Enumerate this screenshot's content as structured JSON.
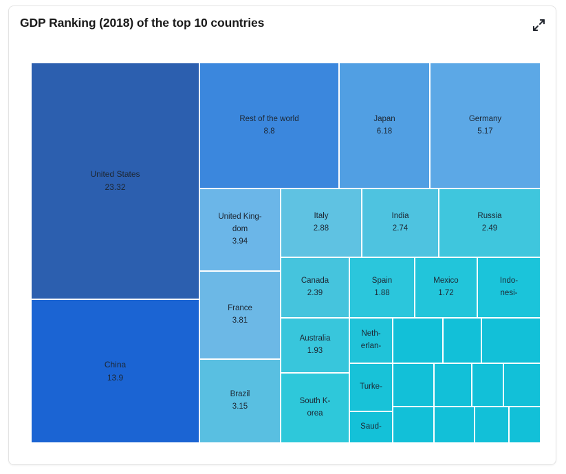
{
  "card": {
    "title": "GDP Ranking (2018) of the top 10 countries",
    "expand_icon": "expand-diagonal-arrows-icon"
  },
  "colors": {
    "united_states": "#2c5faf",
    "china": "#1b64d3",
    "rest_of_world": "#3b87dd",
    "japan": "#519fe3",
    "germany": "#5ca8e6",
    "united_kingdom": "#6bb6e8",
    "france": "#6cb8e6",
    "brazil": "#59bfe1",
    "italy": "#5fc2e2",
    "india": "#4ec3e0",
    "russia": "#3fc6dd",
    "canada": "#45c4dd",
    "australia": "#38c6dc",
    "south_korea": "#2ec8da",
    "spain": "#2bc6dc",
    "mexico": "#22c5da",
    "indonesia": "#1bc4da",
    "netherlands": "#20c3d9",
    "turkey": "#18c2d8",
    "saudi_arabia": "#14c1d8",
    "small": "#12c0d8",
    "tile_border": "#ffffff",
    "card_border": "#e3e3e3",
    "title_text": "#1a1a1a",
    "tile_text": "#1d2733"
  },
  "chart_data": {
    "type": "treemap",
    "title": "GDP Ranking (2018) of the top 10 countries",
    "unit_note": "",
    "value_label_suffix": "",
    "items": [
      {
        "name": "United States",
        "value": "23.32"
      },
      {
        "name": "China",
        "value": "13.9"
      },
      {
        "name": "Rest of the world",
        "value": "8.8"
      },
      {
        "name": "Japan",
        "value": "6.18"
      },
      {
        "name": "Germany",
        "value": "5.17"
      },
      {
        "name": "United King-\ndom",
        "value": "3.94"
      },
      {
        "name": "France",
        "value": "3.81"
      },
      {
        "name": "Brazil",
        "value": "3.15"
      },
      {
        "name": "Italy",
        "value": "2.88"
      },
      {
        "name": "India",
        "value": "2.74"
      },
      {
        "name": "Russia",
        "value": "2.49"
      },
      {
        "name": "Canada",
        "value": "2.39"
      },
      {
        "name": "Australia",
        "value": "1.93"
      },
      {
        "name": "South K-\norea",
        "value": ""
      },
      {
        "name": "Spain",
        "value": "1.88"
      },
      {
        "name": "Mexico",
        "value": "1.72"
      },
      {
        "name": "Indo-\nnesi-",
        "value": ""
      },
      {
        "name": "Neth-\nerlan-",
        "value": ""
      },
      {
        "name": "Turke-",
        "value": ""
      },
      {
        "name": "Saud-",
        "value": ""
      }
    ]
  },
  "tiles": {
    "united_states": {
      "label": "United States",
      "value": "23.32"
    },
    "china": {
      "label": "China",
      "value": "13.9"
    },
    "rest_of_world": {
      "label": "Rest of the world",
      "value": "8.8"
    },
    "japan": {
      "label": "Japan",
      "value": "6.18"
    },
    "germany": {
      "label": "Germany",
      "value": "5.17"
    },
    "united_kingdom": {
      "label": "United King-",
      "label2": "dom",
      "value": "3.94"
    },
    "france": {
      "label": "France",
      "value": "3.81"
    },
    "brazil": {
      "label": "Brazil",
      "value": "3.15"
    },
    "italy": {
      "label": "Italy",
      "value": "2.88"
    },
    "india": {
      "label": "India",
      "value": "2.74"
    },
    "russia": {
      "label": "Russia",
      "value": "2.49"
    },
    "canada": {
      "label": "Canada",
      "value": "2.39"
    },
    "australia": {
      "label": "Australia",
      "value": "1.93"
    },
    "south_korea": {
      "label": "South K-",
      "label2": "orea",
      "value": ""
    },
    "spain": {
      "label": "Spain",
      "value": "1.88"
    },
    "mexico": {
      "label": "Mexico",
      "value": "1.72"
    },
    "indonesia": {
      "label": "Indo-",
      "label2": "nesi-",
      "value": ""
    },
    "netherlands": {
      "label": "Neth-",
      "label2": "erlan-",
      "value": ""
    },
    "turkey": {
      "label": "Turke-",
      "value": ""
    },
    "saudi_arabia": {
      "label": "Saud-",
      "value": ""
    }
  }
}
